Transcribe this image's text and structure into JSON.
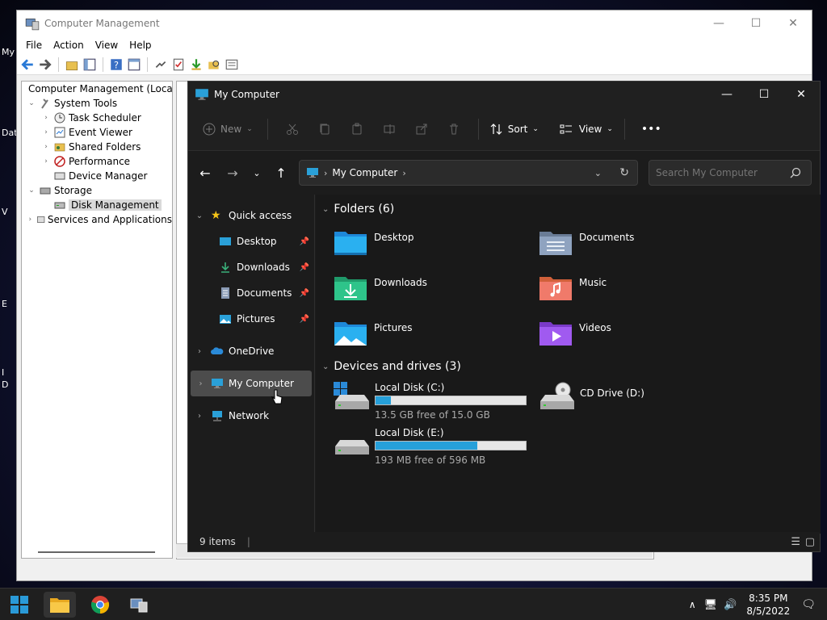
{
  "desktop": {
    "labels": [
      "My",
      "Dat",
      "V",
      "E",
      "I",
      "D"
    ]
  },
  "computer_management": {
    "title": "Computer Management",
    "menu": [
      "File",
      "Action",
      "View",
      "Help"
    ],
    "tree": [
      {
        "label": "Computer Management (Local",
        "level": 0,
        "arrow": ""
      },
      {
        "label": "System Tools",
        "level": 1,
        "arrow": "⌄"
      },
      {
        "label": "Task Scheduler",
        "level": 2,
        "arrow": "›"
      },
      {
        "label": "Event Viewer",
        "level": 2,
        "arrow": "›"
      },
      {
        "label": "Shared Folders",
        "level": 2,
        "arrow": "›"
      },
      {
        "label": "Performance",
        "level": 2,
        "arrow": "›"
      },
      {
        "label": "Device Manager",
        "level": 2,
        "arrow": ""
      },
      {
        "label": "Storage",
        "level": 1,
        "arrow": "⌄"
      },
      {
        "label": "Disk Management",
        "level": 2,
        "arrow": ""
      },
      {
        "label": "Services and Applications",
        "level": 1,
        "arrow": "›"
      }
    ]
  },
  "explorer": {
    "title": "My Computer",
    "toolbar": {
      "new_label": "New",
      "sort_label": "Sort",
      "view_label": "View",
      "more_label": "•••"
    },
    "address": {
      "crumb": "My Computer"
    },
    "search": {
      "placeholder": "Search My Computer"
    },
    "sidebar": {
      "quick_access": "Quick access",
      "pinned": [
        "Desktop",
        "Downloads",
        "Documents",
        "Pictures"
      ],
      "onedrive": "OneDrive",
      "my_computer": "My Computer",
      "network": "Network"
    },
    "folders_header": "Folders (6)",
    "folders": [
      {
        "name": "Desktop",
        "icon": "desktop-folder-icon"
      },
      {
        "name": "Documents",
        "icon": "documents-folder-icon"
      },
      {
        "name": "Downloads",
        "icon": "downloads-folder-icon"
      },
      {
        "name": "Music",
        "icon": "music-folder-icon"
      },
      {
        "name": "Pictures",
        "icon": "pictures-folder-icon"
      },
      {
        "name": "Videos",
        "icon": "videos-folder-icon"
      }
    ],
    "drives_header": "Devices and drives (3)",
    "drives": [
      {
        "name": "Local Disk (C:)",
        "free": "13.5 GB free of 15.0 GB",
        "used_fraction": 0.1
      },
      {
        "name": "CD Drive (D:)"
      },
      {
        "name": "Local Disk (E:)",
        "free": "193 MB free of 596 MB",
        "used_fraction": 0.68
      }
    ],
    "status": "9 items"
  },
  "taskbar": {
    "time": "8:35 PM",
    "date": "8/5/2022"
  },
  "colors": {
    "accent": "#26a0da",
    "folder": "#f4c24c",
    "explorer_bg": "#1c1c1c"
  }
}
